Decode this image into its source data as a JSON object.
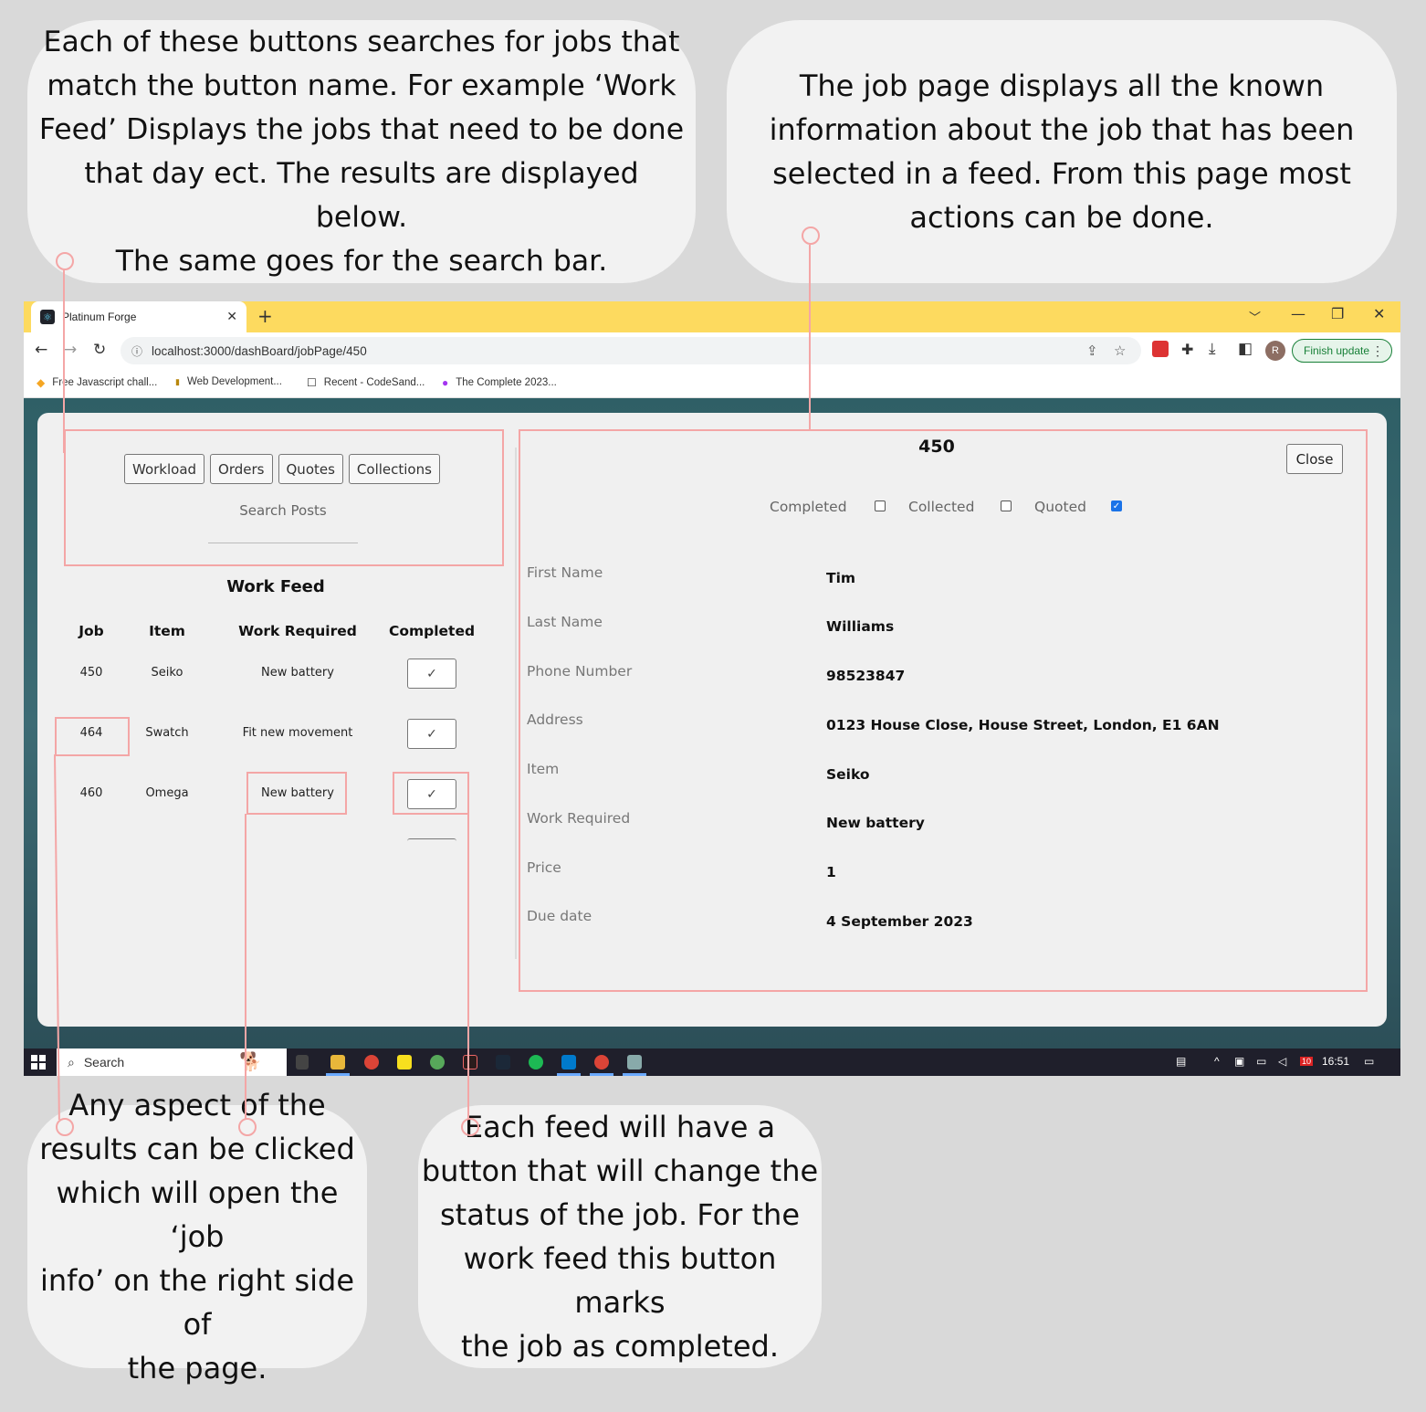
{
  "annotations": {
    "top_left": [
      "Each of these buttons searches for jobs that",
      "match the button name. For example ‘Work",
      "Feed’ Displays the jobs that need to be done",
      "that day ect. The results are displayed below.",
      "The same goes for the search bar."
    ],
    "top_right": [
      "The job page displays all the known",
      "information about the job that has been",
      "selected in a feed. From this page most",
      "actions can be done."
    ],
    "bottom_left": [
      "Any aspect of the",
      "results can be clicked",
      "which will open the ‘job",
      "info’ on the right side of",
      "the page."
    ],
    "bottom_mid": [
      "Each feed will have a",
      "button that will change the",
      "status of the job. For the",
      "work feed this button marks",
      "the job as completed."
    ]
  },
  "browser": {
    "tab_title": "Platinum Forge",
    "url": "localhost:3000/dashBoard/jobPage/450",
    "finish_update": "Finish update",
    "avatar_letter": "R",
    "bookmarks": [
      "Free Javascript chall...",
      "Web Development...",
      "Recent - CodeSand...",
      "The Complete 2023..."
    ]
  },
  "feed": {
    "buttons": [
      "Workload",
      "Orders",
      "Quotes",
      "Collections"
    ],
    "search_placeholder": "Search Posts",
    "title": "Work Feed",
    "columns": [
      "Job",
      "Item",
      "Work Required",
      "Completed"
    ],
    "rows": [
      {
        "job": "450",
        "item": "Seiko",
        "work": "New battery"
      },
      {
        "job": "464",
        "item": "Swatch",
        "work": "Fit new movement"
      },
      {
        "job": "460",
        "item": "Omega",
        "work": "New battery"
      }
    ],
    "check_glyph": "✓"
  },
  "job": {
    "id": "450",
    "close_label": "Close",
    "status": [
      {
        "label": "Completed",
        "checked": false
      },
      {
        "label": "Collected",
        "checked": false
      },
      {
        "label": "Quoted",
        "checked": true
      }
    ],
    "fields": [
      {
        "label": "First Name",
        "value": "Tim"
      },
      {
        "label": "Last Name",
        "value": "Williams"
      },
      {
        "label": "Phone Number",
        "value": "98523847"
      },
      {
        "label": "Address",
        "value": "0123 House Close, House Street, London, E1 6AN"
      },
      {
        "label": "Item",
        "value": "Seiko"
      },
      {
        "label": "Work Required",
        "value": "New battery"
      },
      {
        "label": "Price",
        "value": "1"
      },
      {
        "label": "Due date",
        "value": "4 September 2023"
      }
    ]
  },
  "taskbar": {
    "search_label": "Search",
    "time": "16:51",
    "badge": "10"
  },
  "colors": {
    "callout": "#f4a6a6",
    "tab_bar": "#fdda5f",
    "checkbox_on": "#1a73e8"
  }
}
